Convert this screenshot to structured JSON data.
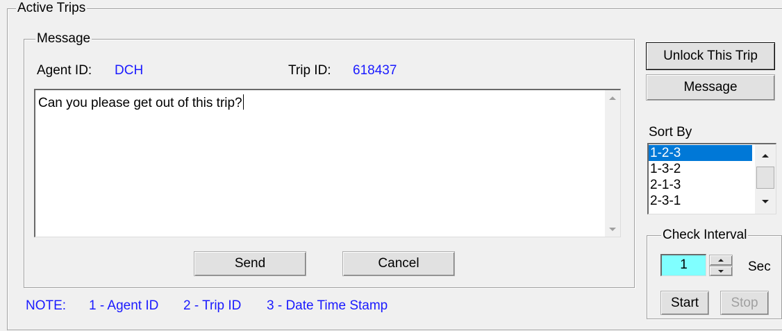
{
  "active_trips": {
    "legend": "Active Trips"
  },
  "message_group": {
    "legend": "Message",
    "agent_id_label": "Agent ID:",
    "agent_id_value": "DCH",
    "trip_id_label": "Trip ID:",
    "trip_id_value": "618437",
    "message_text": "Can you please get out of this trip?",
    "send_label": "Send",
    "cancel_label": "Cancel"
  },
  "side": {
    "unlock_label": "Unlock This Trip",
    "message_label": "Message",
    "sort_by_label": "Sort By",
    "sort_options": [
      "1-2-3",
      "1-3-2",
      "2-1-3",
      "2-3-1"
    ],
    "sort_selected": "1-2-3"
  },
  "check_interval": {
    "legend": "Check Interval",
    "value": "1",
    "unit": "Sec",
    "start_label": "Start",
    "stop_label": "Stop"
  },
  "note": {
    "prefix": "NOTE:",
    "item1": "1 - Agent ID",
    "item2": "2 - Trip ID",
    "item3": "3 - Date Time Stamp"
  },
  "colors": {
    "accent_text": "#1a1aff",
    "selection": "#0078d7",
    "spin_input_bg": "#80ffff"
  }
}
